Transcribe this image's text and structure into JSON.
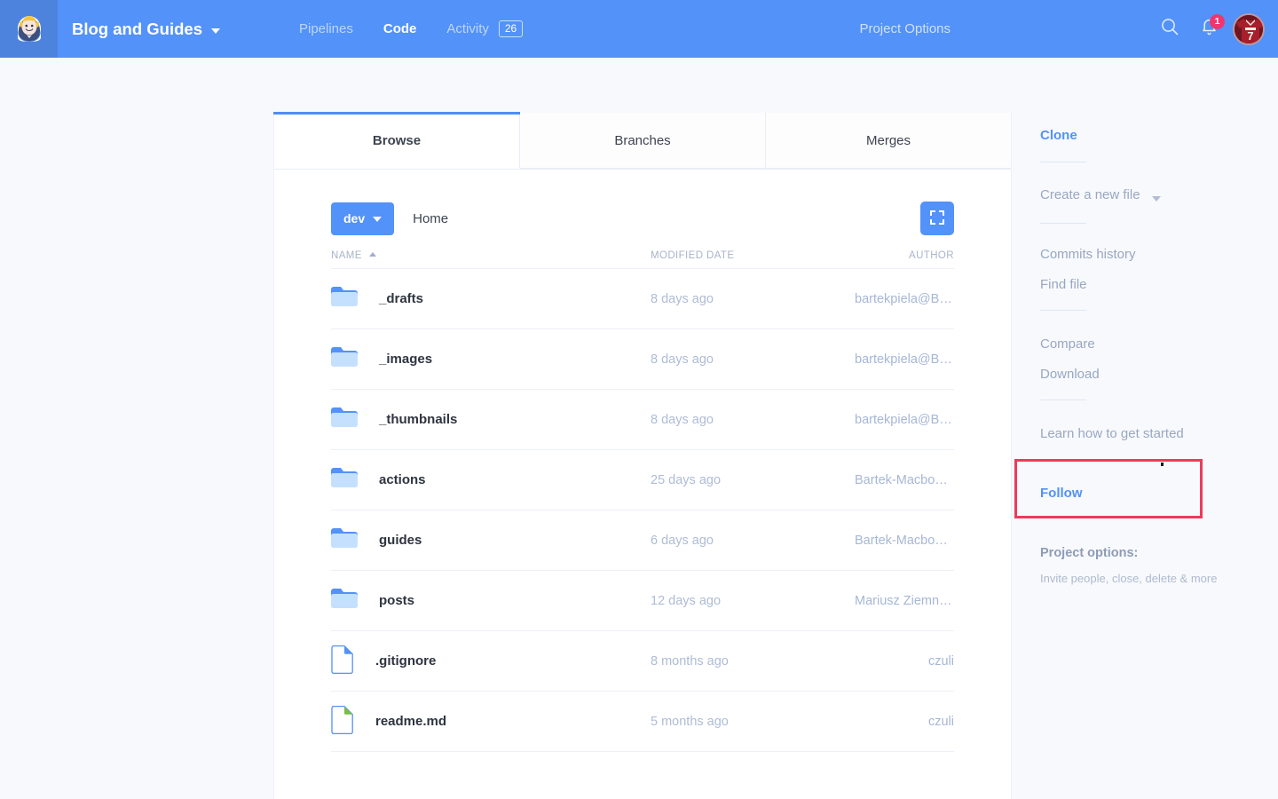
{
  "header": {
    "logo_icon": "jenkins-butler-logo",
    "project_title": "Blog and Guides",
    "nav": [
      {
        "label": "Pipelines",
        "active": false,
        "badge": null
      },
      {
        "label": "Code",
        "active": true,
        "badge": null
      },
      {
        "label": "Activity",
        "active": false,
        "badge": "26"
      }
    ],
    "project_options_label": "Project Options",
    "search_icon": "search-icon",
    "bell_icon": "bell-icon",
    "notification_count": "1",
    "avatar_icon": "user-avatar",
    "colors": {
      "header_bg": "#5392f8",
      "logo_bg": "#4d83dd",
      "badge_bg": "#f0356f"
    }
  },
  "tabs": [
    {
      "label": "Browse",
      "active": true
    },
    {
      "label": "Branches",
      "active": false
    },
    {
      "label": "Merges",
      "active": false
    }
  ],
  "toolbar": {
    "branch_label": "dev",
    "breadcrumb": "Home",
    "expand_icon": "fullscreen-icon"
  },
  "table": {
    "columns": {
      "name": "NAME",
      "modified_date": "MODIFIED DATE",
      "author": "AUTHOR"
    },
    "sort": {
      "column": "NAME",
      "direction": "asc"
    },
    "rows": [
      {
        "icon": "folder-icon",
        "name": "_drafts",
        "modified": "8 days ago",
        "author": "bartekpiela@Barteks-..."
      },
      {
        "icon": "folder-icon",
        "name": "_images",
        "modified": "8 days ago",
        "author": "bartekpiela@Barteks-..."
      },
      {
        "icon": "folder-icon",
        "name": "_thumbnails",
        "modified": "8 days ago",
        "author": "bartekpiela@Barteks-..."
      },
      {
        "icon": "folder-icon",
        "name": "actions",
        "modified": "25 days ago",
        "author": "Bartek-Macbook@Ma..."
      },
      {
        "icon": "folder-icon",
        "name": "guides",
        "modified": "6 days ago",
        "author": "Bartek-Macbook@Ma..."
      },
      {
        "icon": "folder-icon",
        "name": "posts",
        "modified": "12 days ago",
        "author": "Mariusz Ziemniak"
      },
      {
        "icon": "file-icon-blue",
        "name": ".gitignore",
        "modified": "8 months ago",
        "author": "czuli"
      },
      {
        "icon": "file-icon-green",
        "name": "readme.md",
        "modified": "5 months ago",
        "author": "czuli"
      }
    ]
  },
  "sidebar": {
    "clone": "Clone",
    "create_new_file": "Create a new file",
    "commits_history": "Commits history",
    "find_file": "Find file",
    "compare": "Compare",
    "download": "Download",
    "learn_how": "Learn how to get started",
    "follow": "Follow",
    "project_options_title": "Project options:",
    "project_options_sub": "Invite people, close, delete & more"
  },
  "annotation": {
    "highlight_color": "#ec3b5c",
    "highlight_target": "Follow"
  }
}
